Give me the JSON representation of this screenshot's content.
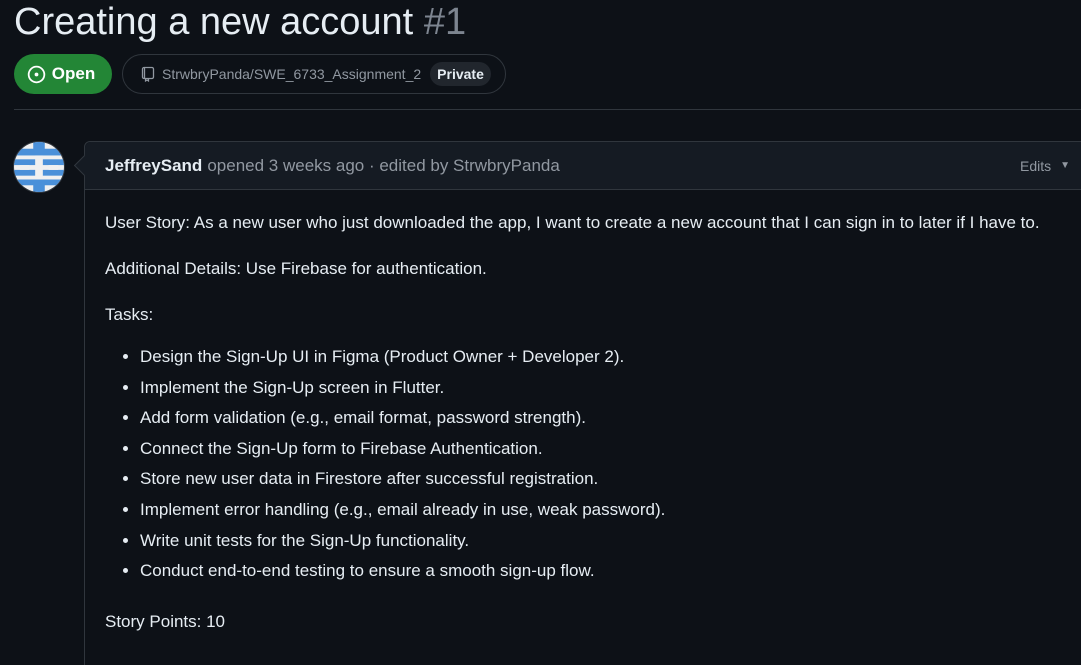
{
  "issue": {
    "title": "Creating a new account",
    "number": "#1",
    "state": "Open",
    "repository": "StrwbryPanda/SWE_6733_Assignment_2",
    "visibility": "Private"
  },
  "comment": {
    "author": "JeffreySand",
    "meta": "opened 3 weeks ago · edited by StrwbryPanda",
    "edits_label": "Edits",
    "user_story": "User Story: As a new user who just downloaded the app, I want to create a new account that I can sign in to later if I have to.",
    "additional_details": "Additional Details: Use Firebase for authentication.",
    "tasks_heading": "Tasks:",
    "tasks": [
      "Design the Sign-Up UI in Figma (Product Owner + Developer 2).",
      "Implement the Sign-Up screen in Flutter.",
      "Add form validation (e.g., email format, password strength).",
      "Connect the Sign-Up form to Firebase Authentication.",
      "Store new user data in Firestore after successful registration.",
      "Implement error handling (e.g., email already in use, weak password).",
      "Write unit tests for the Sign-Up functionality.",
      "Conduct end-to-end testing to ensure a smooth sign-up flow."
    ],
    "story_points": "Story Points: 10"
  },
  "icons": {
    "state": "issue-opened-icon",
    "repo": "repo-icon",
    "edits": "caret-down-icon",
    "avatar": "identicon-avatar"
  },
  "colors": {
    "background": "#0d1117",
    "open_green": "#238636",
    "border": "#30363d",
    "muted_text": "#9198a1",
    "avatar_blue": "#4a90d9"
  }
}
